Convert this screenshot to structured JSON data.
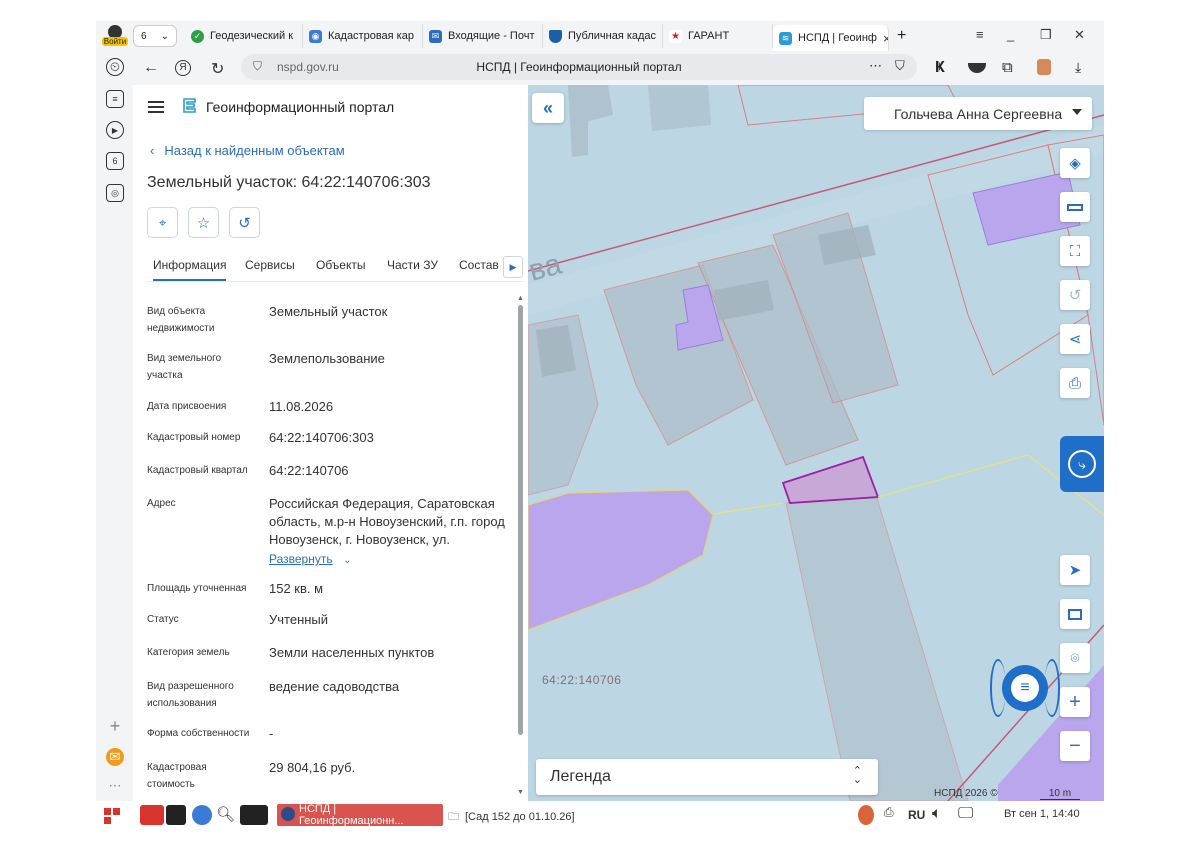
{
  "browser": {
    "login_label": "Войти",
    "tab_count": "6",
    "tabs": [
      {
        "label": "Геодезический к",
        "icon": "green-check-icon",
        "color": "#2e9e44"
      },
      {
        "label": "Кадастровая кар",
        "icon": "cadastral-map-icon",
        "color": "#3b7bd4"
      },
      {
        "label": "Входящие - Почт",
        "icon": "mail-icon",
        "color": "#2a6ebb"
      },
      {
        "label": "Публичная кадас",
        "icon": "shield-icon",
        "color": "#1a5fa8"
      },
      {
        "label": "ГАРАНТ",
        "icon": "garant-icon",
        "color": "#c62828"
      },
      {
        "label": "НСПД | Геоинф",
        "icon": "nspd-icon",
        "color": "#2a9bd6"
      }
    ],
    "url": "nspd.gov.ru",
    "page_title": "НСПД | Геоинформационный портал",
    "sidebar_badge": "6"
  },
  "portal": {
    "name": "Геоинформационный портал",
    "back_link": "Назад к найденным объектам",
    "object_title": "Земельный участок: 64:22:140706:303",
    "tabs": [
      "Информация",
      "Сервисы",
      "Объекты",
      "Части ЗУ",
      "Состав"
    ],
    "info": [
      {
        "label": "Вид объекта недвижимости",
        "value": "Земельный участок"
      },
      {
        "label": "Вид земельного участка",
        "value": "Землепользование"
      },
      {
        "label": "Дата присвоения",
        "value": "11.08.2026"
      },
      {
        "label": "Кадастровый номер",
        "value": "64:22:140706:303"
      },
      {
        "label": "Кадастровый квартал",
        "value": "64:22:140706"
      },
      {
        "label": "Адрес",
        "value": "Российская Федерация, Саратовская область, м.р-н Новоузенский, г.п. город Новоузенск, г. Новоузенск, ул."
      },
      {
        "label": "Площадь уточненная",
        "value": "152 кв. м"
      },
      {
        "label": "Статус",
        "value": "Учтенный"
      },
      {
        "label": "Категория земель",
        "value": "Земли населенных пунктов"
      },
      {
        "label": "Вид разрешенного использования",
        "value": "ведение садоводства"
      },
      {
        "label": "Форма собственности",
        "value": "-"
      },
      {
        "label": "Кадастровая стоимость",
        "value": "29 804,16 руб."
      }
    ],
    "expand_label": "Развернуть"
  },
  "map": {
    "user_name": "Гольчева Анна Сергеевна",
    "street_fragment": "ва",
    "kvartal_label": "64:22:140706",
    "legend_label": "Легенда",
    "copyright": "НСПД 2026 ©",
    "scale_label": "10 m",
    "colors": {
      "parcel_selected": "#9b1fa8",
      "zone_purple": "#b9a6ec",
      "boundary": "#d88080"
    }
  },
  "taskbar": {
    "active_window": "НСПД | Геоинформационн...",
    "file_label": "[Сад 152 до 01.10.26]",
    "lang": "RU",
    "clock": "Вт сен 1, 14:40"
  }
}
